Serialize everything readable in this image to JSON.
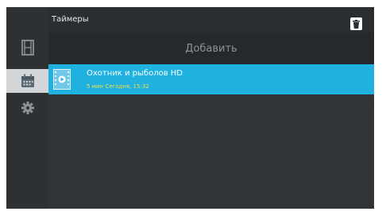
{
  "header": {
    "title": "Таймеры",
    "trash_icon": "trash-icon"
  },
  "sidebar": {
    "items": [
      {
        "id": "recordings",
        "icon": "film-icon",
        "active": false
      },
      {
        "id": "timers",
        "icon": "calendar-icon",
        "active": true
      },
      {
        "id": "settings",
        "icon": "gear-icon",
        "active": false
      }
    ]
  },
  "add_button": {
    "label": "Добавить"
  },
  "timers": [
    {
      "title": "Охотник и рыболов HD",
      "duration": "5 мин",
      "when": "Сегодня, 15:32",
      "icon": "video-file-icon"
    }
  ],
  "colors": {
    "accent": "#1fb1e0",
    "subtitle": "#f0e04a",
    "active_side": "#d2d6d8"
  }
}
